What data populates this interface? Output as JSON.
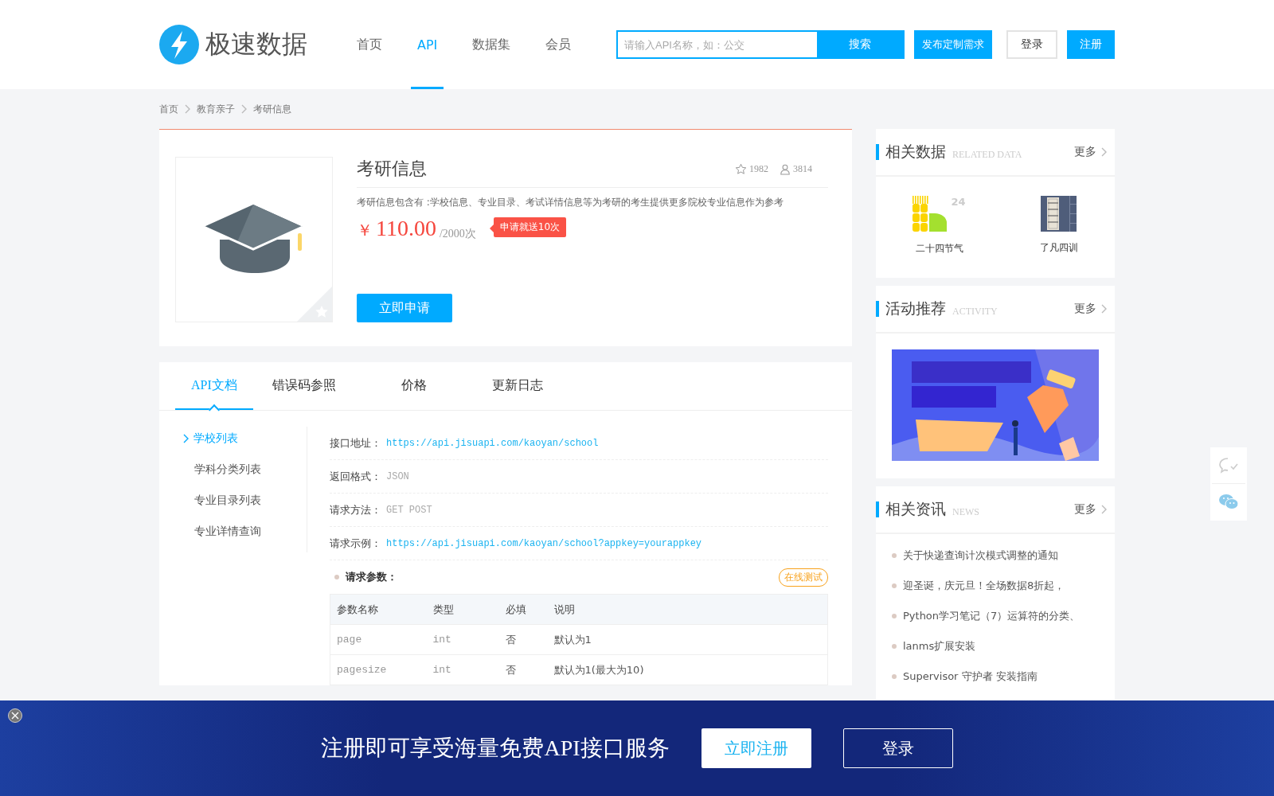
{
  "header": {
    "logo_text": "极速数据",
    "nav": [
      {
        "label": "首页",
        "selected": false
      },
      {
        "label": "API",
        "selected": true
      },
      {
        "label": "数据集",
        "selected": false
      },
      {
        "label": "会员",
        "selected": false
      }
    ],
    "search": {
      "placeholder": "请输入API名称，如：公交"
    },
    "search_button": "搜索",
    "publish_button": "发布定制需求",
    "login_button": "登录",
    "register_button": "注册"
  },
  "breadcrumb": [
    "首页",
    "教育亲子",
    "考研信息"
  ],
  "product": {
    "title": "考研信息",
    "favorites": "1982",
    "users": "3814",
    "description": "考研信息包含有 :学校信息、专业目录、考试详情信息等为考研的考生提供更多院校专业信息作为参考",
    "currency": "￥",
    "price": "110.00",
    "unit": "/2000次",
    "promo": "申请就送10次",
    "apply_button": "立即申请"
  },
  "doc_tabs": [
    {
      "label": "API文档",
      "selected": true
    },
    {
      "label": "错误码参照",
      "selected": false
    },
    {
      "label": "价格",
      "selected": false
    },
    {
      "label": "更新日志",
      "selected": false
    }
  ],
  "doc_menu": [
    {
      "label": "学校列表",
      "selected": true
    },
    {
      "label": "学科分类列表",
      "selected": false
    },
    {
      "label": "专业目录列表",
      "selected": false
    },
    {
      "label": "专业详情查询",
      "selected": false
    }
  ],
  "doc_fields": [
    {
      "label": "接口地址：",
      "value": "https://api.jisuapi.com/kaoyan/school",
      "kind": "link"
    },
    {
      "label": "返回格式：",
      "value": "JSON",
      "kind": "plain"
    },
    {
      "label": "请求方法：",
      "value": "GET POST",
      "kind": "plain"
    },
    {
      "label": "请求示例：",
      "value": "https://api.jisuapi.com/kaoyan/school?appkey=yourappkey",
      "kind": "link"
    }
  ],
  "params": {
    "title": "请求参数：",
    "test_button": "在线测试",
    "columns": [
      "参数名称",
      "类型",
      "必填",
      "说明"
    ],
    "rows": [
      [
        "page",
        "int",
        "否",
        "默认为1"
      ],
      [
        "pagesize",
        "int",
        "否",
        "默认为1(最大为10)"
      ]
    ]
  },
  "related_data": {
    "title": "相关数据",
    "subtitle": "RELATED DATA",
    "more": "更多",
    "items": [
      {
        "name": "二十四节气",
        "kind": "wheat",
        "badge": "24"
      },
      {
        "name": "了凡四训",
        "kind": "book"
      }
    ]
  },
  "activity": {
    "title": "活动推荐",
    "subtitle": "ACTIVITY",
    "more": "更多"
  },
  "news": {
    "title": "相关资讯",
    "subtitle": "NEWS",
    "more": "更多",
    "items": [
      "关于快递查询计次模式调整的通知",
      "迎圣诞，庆元旦！全场数据8折起，",
      "Python学习笔记（7）运算符的分类、",
      "lanms扩展安装",
      "Supervisor 守护者 安装指南"
    ]
  },
  "bottom_banner": {
    "text": "注册即可享受海量免费API接口服务",
    "register_button": "立即注册",
    "login_button": "登录"
  }
}
